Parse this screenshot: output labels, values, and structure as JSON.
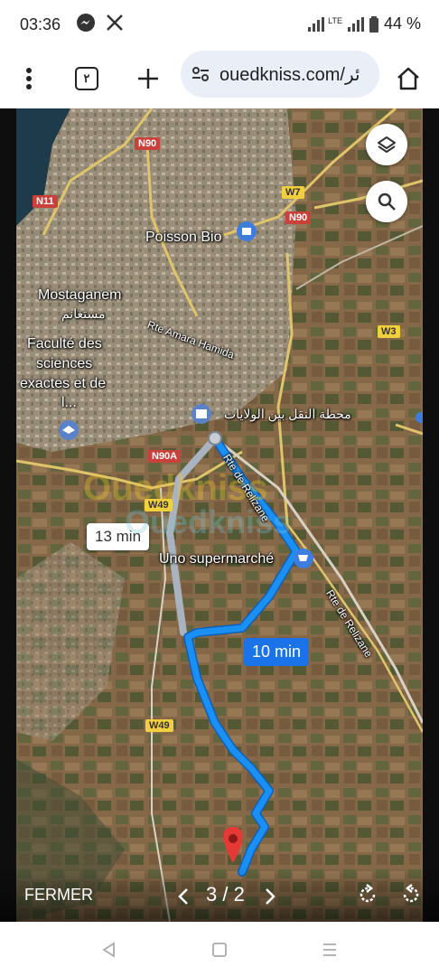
{
  "status": {
    "time": "03:36",
    "battery": "44 %",
    "network": "LTE"
  },
  "browser": {
    "tab_count": "٢",
    "url": "ouedkniss.com/ئر"
  },
  "map": {
    "places": {
      "poisson_bio": "Poisson Bio",
      "mostaganem": "Mostaganem",
      "mostaganem_ar": "مستغانم",
      "faculte_line1": "Faculté des",
      "faculte_line2": "sciences",
      "faculte_line3": "exactes et de",
      "faculte_line4": "l...",
      "rte_amara": "Rte Amara Hamida",
      "station_ar": "محطة النقل بين الولايات",
      "uno": "Uno supermarché",
      "rte_relizane_1": "Rte de Relizane",
      "rte_relizane_2": "Rte de Relizane"
    },
    "roads": {
      "n90_top": "N90",
      "n11": "N11",
      "w7": "W7",
      "n90_right": "N90",
      "w3": "W3",
      "n90a": "N90A",
      "w49_top": "W49",
      "w49_bottom": "W49"
    },
    "routes": {
      "alt_time": "13 min",
      "main_time": "10 min"
    },
    "watermark": "Ouedkniss",
    "colors": {
      "route": "#1a90f5",
      "alt_route": "#a9b3bf",
      "pin": "#e53935"
    },
    "icons": [
      "layers-icon",
      "search-icon"
    ]
  },
  "viewer": {
    "close_label": "FERMER",
    "counter": "3 / 2"
  }
}
